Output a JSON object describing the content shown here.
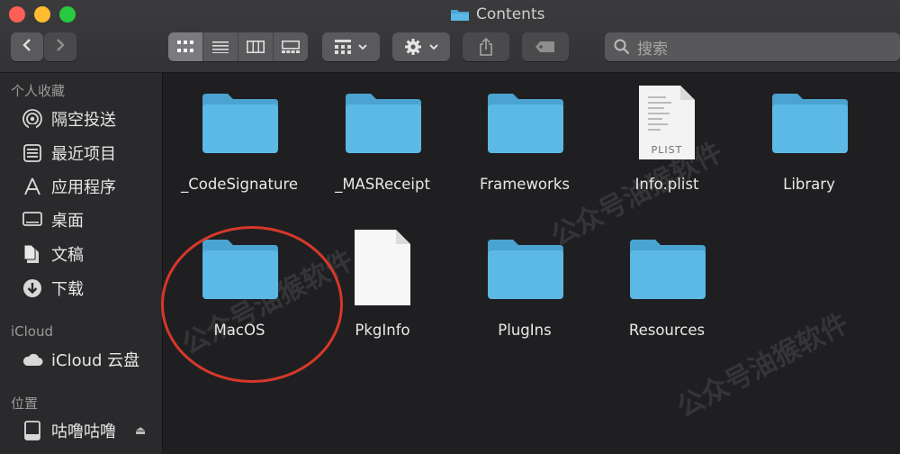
{
  "window": {
    "title": "Contents"
  },
  "toolbar": {
    "back_icon": "chevron-left-icon",
    "forward_icon": "chevron-right-icon",
    "view_modes": [
      "icon-view",
      "list-view",
      "column-view",
      "gallery-view"
    ],
    "active_view": "icon-view",
    "group_icon": "grid-icon",
    "action_icon": "gear-icon",
    "share_icon": "share-icon",
    "tag_icon": "tag-icon",
    "search_placeholder": "搜索"
  },
  "sidebar": {
    "favorites_heading": "个人收藏",
    "favorites": [
      {
        "label": "隔空投送",
        "icon": "airdrop-icon"
      },
      {
        "label": "最近项目",
        "icon": "recents-icon"
      },
      {
        "label": "应用程序",
        "icon": "applications-icon"
      },
      {
        "label": "桌面",
        "icon": "desktop-icon"
      },
      {
        "label": "文稿",
        "icon": "documents-icon"
      },
      {
        "label": "下载",
        "icon": "downloads-icon"
      }
    ],
    "icloud_heading": "iCloud",
    "icloud": [
      {
        "label": "iCloud 云盘",
        "icon": "cloud-icon"
      }
    ],
    "locations_heading": "位置",
    "locations": [
      {
        "label": "咕噜咕噜",
        "icon": "disk-icon",
        "eject": "⏏"
      }
    ]
  },
  "files": [
    {
      "name": "_CodeSignature",
      "type": "folder"
    },
    {
      "name": "_MASReceipt",
      "type": "folder"
    },
    {
      "name": "Frameworks",
      "type": "folder"
    },
    {
      "name": "Info.plist",
      "type": "plist",
      "badge": "PLIST"
    },
    {
      "name": "Library",
      "type": "folder"
    },
    {
      "name": "MacOS",
      "type": "folder",
      "highlighted": true
    },
    {
      "name": "PkgInfo",
      "type": "document"
    },
    {
      "name": "PlugIns",
      "type": "folder"
    },
    {
      "name": "Resources",
      "type": "folder"
    }
  ],
  "watermark": "公众号油猴软件",
  "colors": {
    "folder": "#5cb8e4",
    "folder_tab": "#4aa3d1",
    "highlight_circle": "#d6382a"
  }
}
